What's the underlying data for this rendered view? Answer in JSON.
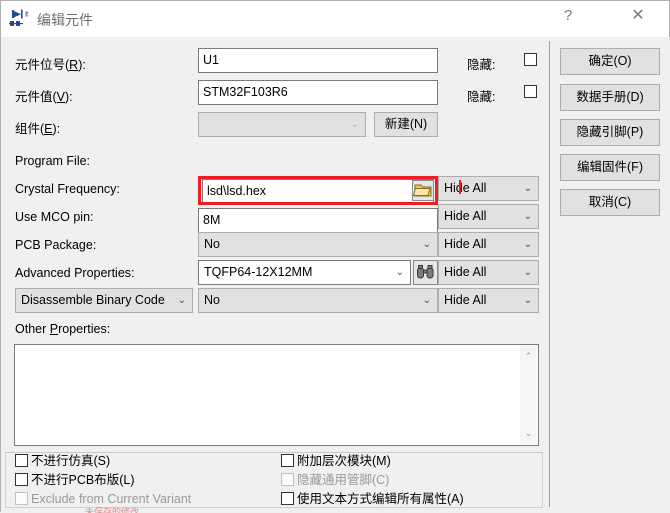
{
  "window": {
    "title": "编辑元件",
    "icon": "component-icon",
    "help_label": "?",
    "close_label": "✕"
  },
  "fields": {
    "designator": {
      "label_pre": "元件位号(",
      "label_key": "R",
      "label_post": "):",
      "value": "U1",
      "hide_label": "隐藏:",
      "hide_checked": false
    },
    "value": {
      "label_pre": "元件值(",
      "label_key": "V",
      "label_post": "):",
      "value": "STM32F103R6",
      "hide_label": "隐藏:",
      "hide_checked": false
    },
    "component": {
      "label_pre": "组件(",
      "label_key": "E",
      "label_post": "):",
      "value": "",
      "new_button": "新建(N)"
    },
    "program_file": {
      "label": "Program File:",
      "value": "lsd\\lsd.hex",
      "browse_icon": "folder-icon",
      "hide_value": "Hide All"
    },
    "crystal_frequency": {
      "label": "Crystal Frequency:",
      "value": "8M",
      "hide_value": "Hide All"
    },
    "use_mco_pin": {
      "label": "Use MCO pin:",
      "value": "No",
      "hide_value": "Hide All"
    },
    "pcb_package": {
      "label": "PCB Package:",
      "value": "TQFP64-12X12MM",
      "browse_icon": "binoculars-icon",
      "hide_value": "Hide All"
    },
    "advanced_properties": {
      "label": "Advanced Properties:",
      "selector_value": "Disassemble Binary Code",
      "value": "No",
      "hide_value": "Hide All"
    },
    "other_properties": {
      "label_pre": "Other ",
      "label_key": "P",
      "label_post": "roperties:",
      "value": ""
    }
  },
  "arrows": {
    "down": "⌄",
    "up": "⌃"
  },
  "checkboxes": {
    "left": [
      {
        "label": "不进行仿真(S)",
        "checked": false,
        "disabled": false
      },
      {
        "label": "不进行PCB布版(L)",
        "checked": false,
        "disabled": false
      },
      {
        "label": "Exclude from Current Variant",
        "checked": false,
        "disabled": true
      }
    ],
    "right": [
      {
        "label": "附加层次模块(M)",
        "checked": false,
        "disabled": false
      },
      {
        "label": "隐藏通用管脚(C)",
        "checked": false,
        "disabled": true
      },
      {
        "label": "使用文本方式编辑所有属性(A)",
        "checked": false,
        "disabled": false
      }
    ]
  },
  "buttons": [
    {
      "label": "确定(O)",
      "name": "ok-button"
    },
    {
      "label": "数据手册(D)",
      "name": "datasheet-button"
    },
    {
      "label": "隐藏引脚(P)",
      "name": "hide-pins-button"
    },
    {
      "label": "编辑固件(F)",
      "name": "edit-firmware-button"
    },
    {
      "label": "取消(C)",
      "name": "cancel-button"
    }
  ],
  "annotation": {
    "highlight_color": "#ee1c25",
    "bottom_text": "未保存的修改"
  }
}
